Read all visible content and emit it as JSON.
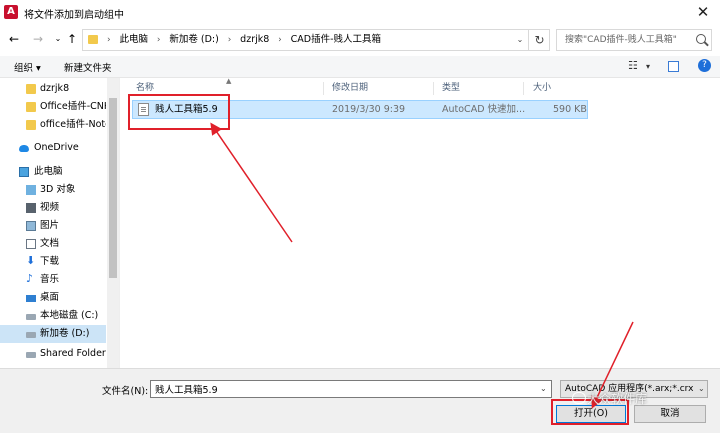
{
  "window": {
    "title": "将文件添加到启动组中",
    "app_icon": "autocad-icon",
    "close_icon": "close-icon"
  },
  "nav": {
    "back": "back-arrow-icon",
    "forward": "forward-arrow-icon",
    "up": "up-arrow-icon"
  },
  "address": {
    "crumbs": [
      "此电脑",
      "新加卷 (D:)",
      "dzrjk8",
      "CAD插件-贱人工具箱"
    ]
  },
  "search": {
    "placeholder": "搜索\"CAD插件-贱人工具箱\""
  },
  "toolbar": {
    "organize": "组织 ▾",
    "new_folder": "新建文件夹"
  },
  "sidebar": {
    "items": [
      {
        "label": "dzrjk8",
        "icon": "folder-icon"
      },
      {
        "label": "Office插件-CNK",
        "icon": "folder-icon"
      },
      {
        "label": "office插件-Note",
        "icon": "folder-icon"
      },
      {
        "label": "OneDrive",
        "icon": "onedrive-cloud-icon"
      },
      {
        "label": "此电脑",
        "icon": "this-pc-icon"
      },
      {
        "label": "3D 对象",
        "icon": "3d-objects-icon"
      },
      {
        "label": "视频",
        "icon": "videos-icon"
      },
      {
        "label": "图片",
        "icon": "pictures-icon"
      },
      {
        "label": "文档",
        "icon": "documents-icon"
      },
      {
        "label": "下载",
        "icon": "downloads-icon"
      },
      {
        "label": "音乐",
        "icon": "music-icon"
      },
      {
        "label": "桌面",
        "icon": "desktop-icon"
      },
      {
        "label": "本地磁盘 (C:)",
        "icon": "drive-icon"
      },
      {
        "label": "新加卷 (D:)",
        "icon": "drive-icon"
      },
      {
        "label": "Shared Folders",
        "icon": "shared-folders-icon"
      }
    ]
  },
  "filelist": {
    "columns": [
      "名称",
      "修改日期",
      "类型",
      "大小"
    ],
    "rows": [
      {
        "name": "贱人工具箱5.9",
        "modified": "2019/3/30 9:39",
        "type": "AutoCAD 快速加...",
        "size": "590 KB"
      }
    ]
  },
  "bottom": {
    "filename_label": "文件名(N):",
    "filename_value": "贱人工具箱5.9",
    "filetype_value": "AutoCAD 应用程序(*.arx;*.crx",
    "open_button": "打开(O)",
    "cancel_button": "取消"
  },
  "watermark": "大众软件库",
  "colors": {
    "annotation_red": "#e0202a",
    "selection": "#cce8ff",
    "accent": "#0078d7"
  }
}
